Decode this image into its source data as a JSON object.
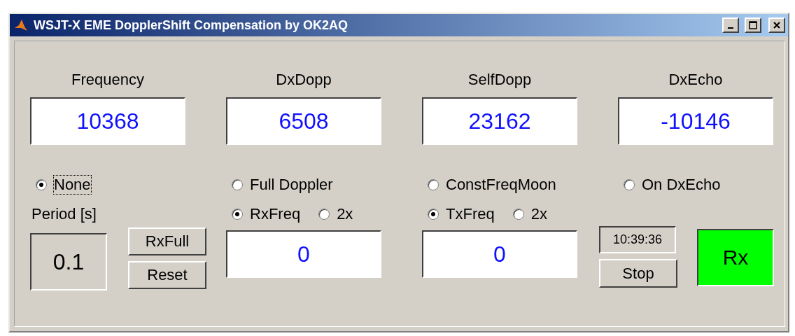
{
  "window": {
    "title": "WSJT-X EME DopplerShift Compensation by OK2AQ"
  },
  "readouts": [
    {
      "label": "Frequency",
      "value": "10368"
    },
    {
      "label": "DxDopp",
      "value": "6508"
    },
    {
      "label": "SelfDopp",
      "value": "23162"
    },
    {
      "label": "DxEcho",
      "value": "-10146"
    }
  ],
  "modes": [
    {
      "label": "None",
      "selected": true,
      "focused": true
    },
    {
      "label": "Full Doppler",
      "selected": false,
      "focused": false
    },
    {
      "label": "ConstFreqMoon",
      "selected": false,
      "focused": false
    },
    {
      "label": "On DxEcho",
      "selected": false,
      "focused": false
    }
  ],
  "period": {
    "label": "Period [s]",
    "value": "0.1"
  },
  "period_buttons": [
    "RxFull",
    "Reset"
  ],
  "rx": {
    "options": [
      {
        "label": "RxFreq",
        "selected": true
      },
      {
        "label": "2x",
        "selected": false
      }
    ],
    "value": "0"
  },
  "tx": {
    "options": [
      {
        "label": "TxFreq",
        "selected": true
      },
      {
        "label": "2x",
        "selected": false
      }
    ],
    "value": "0"
  },
  "clock": "10:39:36",
  "stop_button": "Stop",
  "status": {
    "label": "Rx",
    "on": true
  }
}
